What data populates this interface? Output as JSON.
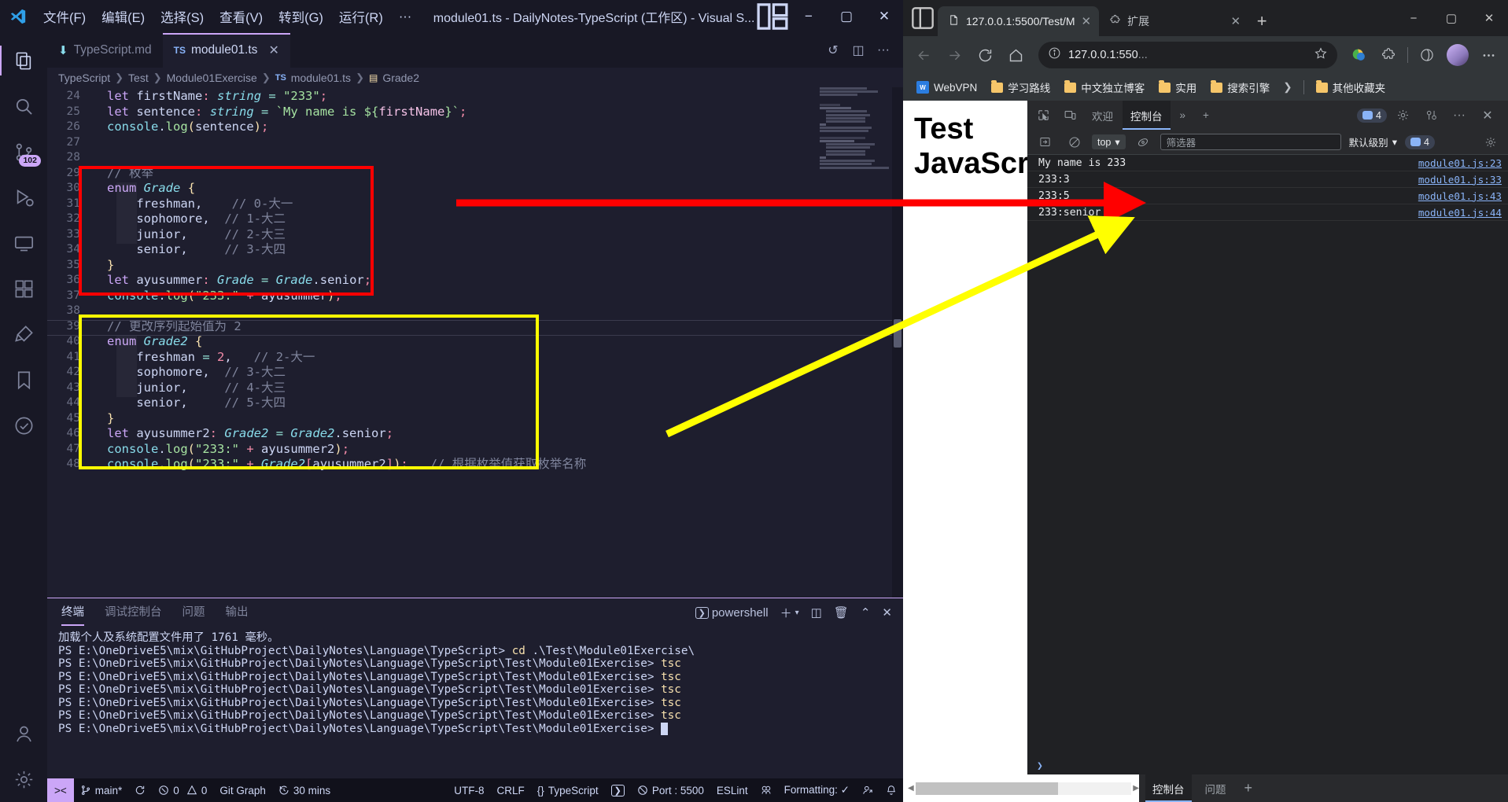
{
  "vscode": {
    "titlebar": {
      "menu": [
        "文件(F)",
        "编辑(E)",
        "选择(S)",
        "查看(V)",
        "转到(G)",
        "运行(R)",
        "···"
      ],
      "title": "module01.ts - DailyNotes-TypeScript (工作区) - Visual S...",
      "minimize": "−",
      "maximize": "▢",
      "close": "✕"
    },
    "activitybar": {
      "items": [
        {
          "name": "explorer-icon",
          "badge": ""
        },
        {
          "name": "search-icon",
          "badge": ""
        },
        {
          "name": "source-control-icon",
          "badge": "102"
        },
        {
          "name": "run-debug-icon",
          "badge": ""
        },
        {
          "name": "remote-explorer-icon",
          "badge": ""
        },
        {
          "name": "extensions-icon",
          "badge": ""
        },
        {
          "name": "testing-icon",
          "badge": ""
        },
        {
          "name": "bookmarks-icon",
          "badge": ""
        },
        {
          "name": "todo-tree-icon",
          "badge": ""
        }
      ],
      "bottom": [
        {
          "name": "accounts-icon"
        },
        {
          "name": "settings-gear-icon"
        }
      ]
    },
    "tabs": [
      {
        "label": "TypeScript.md",
        "icon": "markdown-icon",
        "active": false
      },
      {
        "label": "module01.ts",
        "icon": "typescript-icon",
        "active": true,
        "close": "✕"
      }
    ],
    "breadcrumb": [
      "TypeScript",
      "Test",
      "Module01Exercise",
      "module01.ts",
      "Grade2"
    ],
    "code_lines": [
      {
        "n": "24",
        "html": "<span class='k'>let</span> <span class='pl'>firstName</span><span class='nu'>:</span> <span class='ty'>string</span> <span class='op'>=</span> <span class='st'>\"233\"</span><span class='nu'>;</span>"
      },
      {
        "n": "25",
        "html": "<span class='k'>let</span> <span class='pl'>sentence</span><span class='nu'>:</span> <span class='ty'>string</span> <span class='op'>=</span> <span class='st'>`My name is ${</span><span class='vr'>firstName</span><span class='st'>}`</span><span class='nu'>;</span>"
      },
      {
        "n": "26",
        "html": "<span class='ob'>console</span><span class='pl'>.</span><span class='fn'>log</span><span class='pa'>(</span><span class='pl'>sentence</span><span class='pa'>)</span><span class='nu'>;</span>"
      },
      {
        "n": "27",
        "html": ""
      },
      {
        "n": "28",
        "html": ""
      },
      {
        "n": "29",
        "html": "<span class='cm'>// 枚举</span>"
      },
      {
        "n": "30",
        "html": "<span class='k'>enum</span> <span class='ty'>Grade</span> <span class='pa'>{</span>"
      },
      {
        "n": "31",
        "html": "    <span class='pl'>freshman,</span>    <span class='cm'>// 0-大一</span>"
      },
      {
        "n": "32",
        "html": "    <span class='pl'>sophomore,</span>  <span class='cm'>// 1-大二</span>"
      },
      {
        "n": "33",
        "html": "    <span class='pl'>junior,</span>     <span class='cm'>// 2-大三</span>"
      },
      {
        "n": "34",
        "html": "    <span class='pl'>senior,</span>     <span class='cm'>// 3-大四</span>"
      },
      {
        "n": "35",
        "html": "<span class='pa'>}</span>"
      },
      {
        "n": "36",
        "html": "<span class='k'>let</span> <span class='pl'>ayusummer</span><span class='nu'>:</span> <span class='ty'>Grade</span> <span class='op'>=</span> <span class='ty'>Grade</span><span class='pl'>.senior</span><span class='nu'>;</span>"
      },
      {
        "n": "37",
        "html": "<span class='ob'>console</span><span class='pl'>.</span><span class='fn'>log</span><span class='pa'>(</span><span class='st'>\"233:\"</span> <span class='nu'>+</span> <span class='pl'>ayusummer</span><span class='pa'>)</span><span class='nu'>;</span>"
      },
      {
        "n": "38",
        "html": ""
      },
      {
        "n": "39",
        "html": "<span class='cm'>// 更改序列起始值为 2</span>"
      },
      {
        "n": "40",
        "html": "<span class='k'>enum</span> <span class='ty'>Grade2</span> <span class='pa'>{</span>"
      },
      {
        "n": "41",
        "html": "    <span class='pl'>freshman</span> <span class='op'>=</span> <span class='nu'>2</span><span class='pl'>,</span>   <span class='cm'>// 2-大一</span>"
      },
      {
        "n": "42",
        "html": "    <span class='pl'>sophomore,</span>  <span class='cm'>// 3-大二</span>"
      },
      {
        "n": "43",
        "html": "    <span class='pl'>junior,</span>     <span class='cm'>// 4-大三</span>"
      },
      {
        "n": "44",
        "html": "    <span class='pl'>senior,</span>     <span class='cm'>// 5-大四</span>"
      },
      {
        "n": "45",
        "html": "<span class='pa'>}</span>"
      },
      {
        "n": "46",
        "html": "<span class='k'>let</span> <span class='pl'>ayusummer2</span><span class='nu'>:</span> <span class='ty'>Grade2</span> <span class='op'>=</span> <span class='ty'>Grade2</span><span class='pl'>.senior</span><span class='nu'>;</span>"
      },
      {
        "n": "47",
        "html": "<span class='ob'>console</span><span class='pl'>.</span><span class='fn'>log</span><span class='pa'>(</span><span class='st'>\"233:\"</span> <span class='nu'>+</span> <span class='pl'>ayusummer2</span><span class='pa'>)</span><span class='nu'>;</span>"
      },
      {
        "n": "48",
        "html": "<span class='ob'>console</span><span class='pl'>.</span><span class='fn'>log</span><span class='pa'>(</span><span class='st'>\"233:\"</span> <span class='nu'>+</span> <span class='ty'>Grade2</span><span class='nu'>[</span><span class='pl'>ayusummer2</span><span class='nu'>]</span><span class='pa'>)</span><span class='nu'>;</span>   <span class='cm'>// 根据枚举值获取枚举名称</span>"
      }
    ],
    "highlights": [
      {
        "name": "red-enum-grade-box",
        "color": "#ff0000"
      },
      {
        "name": "yellow-enum-grade2-box",
        "color": "#ffff00"
      }
    ],
    "panel": {
      "tabs": [
        "终端",
        "调试控制台",
        "问题",
        "输出"
      ],
      "active_tab": "终端",
      "shell_label": "powershell",
      "actions": [
        "new-terminal-plus",
        "split-terminal",
        "kill-terminal",
        "maximize-panel",
        "close-panel"
      ],
      "terminal_lines": [
        "加载个人及系统配置文件用了 1761 毫秒。",
        "PS E:\\OneDriveE5\\mix\\GitHubProject\\DailyNotes\\Language\\TypeScript> cd .\\Test\\Module01Exercise\\",
        "PS E:\\OneDriveE5\\mix\\GitHubProject\\DailyNotes\\Language\\TypeScript\\Test\\Module01Exercise> tsc",
        "PS E:\\OneDriveE5\\mix\\GitHubProject\\DailyNotes\\Language\\TypeScript\\Test\\Module01Exercise> tsc",
        "PS E:\\OneDriveE5\\mix\\GitHubProject\\DailyNotes\\Language\\TypeScript\\Test\\Module01Exercise> tsc",
        "PS E:\\OneDriveE5\\mix\\GitHubProject\\DailyNotes\\Language\\TypeScript\\Test\\Module01Exercise> tsc",
        "PS E:\\OneDriveE5\\mix\\GitHubProject\\DailyNotes\\Language\\TypeScript\\Test\\Module01Exercise> tsc",
        "PS E:\\OneDriveE5\\mix\\GitHubProject\\DailyNotes\\Language\\TypeScript\\Test\\Module01Exercise> "
      ]
    },
    "statusbar": {
      "remote": "><",
      "branch": "main*",
      "sync": "sync-icon",
      "errors": "0",
      "warnings": "0",
      "git_graph": "Git Graph",
      "timer": "30 mins",
      "encoding": "UTF-8",
      "eol": "CRLF",
      "language": "TypeScript",
      "port": "Port : 5500",
      "eslint": "ESLint",
      "formatting": "Formatting: ✓",
      "live_share": "live-share-icon",
      "bell": "bell-icon"
    }
  },
  "browser": {
    "tabs": [
      {
        "label": "127.0.0.1:5500/Test/M",
        "icon": "page-icon",
        "active": true,
        "close": "✕"
      },
      {
        "label": "扩展",
        "icon": "puzzle-icon",
        "active": false,
        "close": "✕"
      }
    ],
    "newtab": "+",
    "wincontrols": {
      "minimize": "−",
      "maximize": "▢",
      "close": "✕"
    },
    "omnibox": {
      "text": "127.0.0.1:550",
      "dim": "...",
      "info_icon": "info-icon",
      "star_icon": "star-add-icon"
    },
    "toolbar_icons": [
      "back-arrow-icon",
      "forward-arrow-icon",
      "reload-icon",
      "home-icon",
      "collections-icon",
      "extensions-puzzle-icon",
      "browser-essentials-icon",
      "more-menu-icon"
    ],
    "bookmarks": [
      {
        "label": "WebVPN",
        "icon": "webvpn-icon"
      },
      {
        "label": "学习路线",
        "icon": "folder-icon"
      },
      {
        "label": "中文独立博客",
        "icon": "folder-icon"
      },
      {
        "label": "实用",
        "icon": "folder-icon"
      },
      {
        "label": "搜索引擎",
        "icon": "folder-icon"
      },
      {
        "label": "其他收藏夹",
        "icon": "folder-icon"
      }
    ],
    "bookmarks_overflow": "❯",
    "page": {
      "heading_line1": "Test",
      "heading_line2": "JavaScrip"
    },
    "devtools": {
      "tabs": [
        "欢迎",
        "控制台"
      ],
      "active_tab": "控制台",
      "overflow": "»",
      "add": "+",
      "issue_badge": "4",
      "toolbar": {
        "sidebar_icon": "console-sidebar-icon",
        "clear_icon": "clear-console-icon",
        "context": "top",
        "eye_icon": "live-expression-icon",
        "filter_placeholder": "筛选器",
        "level": "默认级别",
        "level_badge": "4",
        "settings_icon": "settings-gear-icon"
      },
      "messages": [
        {
          "text": "My name is 233",
          "source": "module01.js:23"
        },
        {
          "text": "233:3",
          "source": "module01.js:33"
        },
        {
          "text": "233:5",
          "source": "module01.js:43"
        },
        {
          "text": "233:senior",
          "source": "module01.js:44"
        }
      ],
      "prompt": "❯",
      "bottom_tabs": [
        "控制台",
        "问题"
      ],
      "bottom_active": "控制台",
      "bottom_add": "+"
    }
  },
  "annotations": [
    {
      "name": "red-arrow-to-console-233-3",
      "color": "#ff0000",
      "from": "enum-grade-box",
      "to": "console-row-233-3"
    },
    {
      "name": "yellow-arrow-to-console-233-senior",
      "color": "#ffff00",
      "from": "enum-grade2-box",
      "to": "console-row-233-senior"
    }
  ]
}
